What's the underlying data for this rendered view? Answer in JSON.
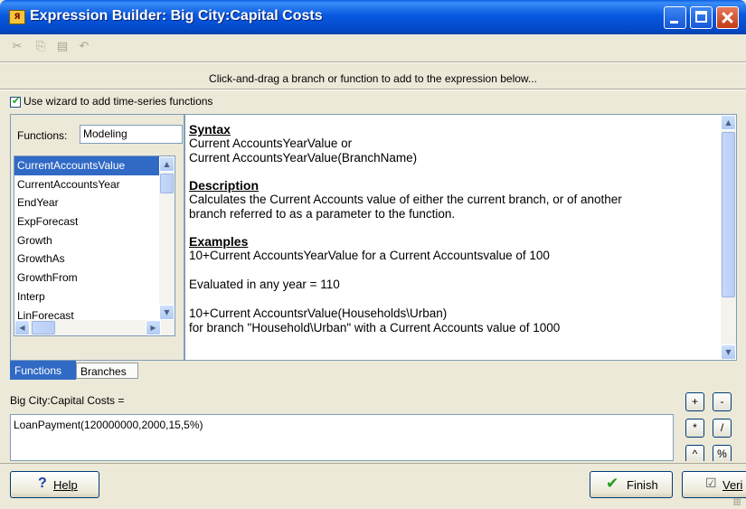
{
  "window": {
    "title": "Expression Builder: Big City:Capital Costs",
    "app_icon_text": "Я"
  },
  "toolbar": {
    "items": [
      {
        "name": "cut-icon",
        "glyph": "✂"
      },
      {
        "name": "copy-icon",
        "glyph": "⎘"
      },
      {
        "name": "paste-icon",
        "glyph": "📋"
      },
      {
        "name": "undo-icon",
        "glyph": "↶"
      }
    ]
  },
  "instruction": "Click-and-drag a branch or function to add to the expression below...",
  "wizard": {
    "checked": true,
    "label": "Use wizard to add time-series functions"
  },
  "functions": {
    "label": "Functions:",
    "category": "Modeling",
    "items": [
      "CurrentAccountsValue",
      "CurrentAccountsYear",
      "EndYear",
      "ExpForecast",
      "Growth",
      "GrowthAs",
      "GrowthFrom",
      "Interp",
      "LinForecast"
    ],
    "selected_index": 0
  },
  "tabs": [
    {
      "label": "Functions",
      "active": true
    },
    {
      "label": "Branches",
      "active": false
    }
  ],
  "help": {
    "syntax_heading": "Syntax",
    "syntax_lines": [
      "Current AccountsYearValue or",
      "Current AccountsYearValue(BranchName)"
    ],
    "description_heading": "Description",
    "description_lines": [
      "Calculates the Current Accounts value of either the current branch, or of another",
      "branch referred to as a parameter to the function."
    ],
    "examples_heading": "Examples",
    "example_line_1": "10+Current AccountsYearValue for a Current Accountsvalue of 100",
    "example_line_2": "Evaluated in any year = 110",
    "example_line_3": "10+Current AccountsrValue(Households\\Urban)",
    "example_line_4": "for branch \"Household\\Urban\" with a Current Accounts value of 1000"
  },
  "expression": {
    "label": "Big City:Capital Costs =",
    "value": "LoanPayment(120000000,2000,15,5%)"
  },
  "operators": {
    "plus": "+",
    "minus": "-",
    "multiply": "*",
    "divide": "/",
    "power": "^",
    "percent": "%"
  },
  "buttons": {
    "help_label": "Help",
    "finish_label": "Finish",
    "verify_label": "Veri"
  },
  "colors": {
    "titlebar": "#0a5fe4",
    "selection": "#316ac5",
    "window_bg": "#ece9d8",
    "finish_check": "#1e9e1e"
  }
}
